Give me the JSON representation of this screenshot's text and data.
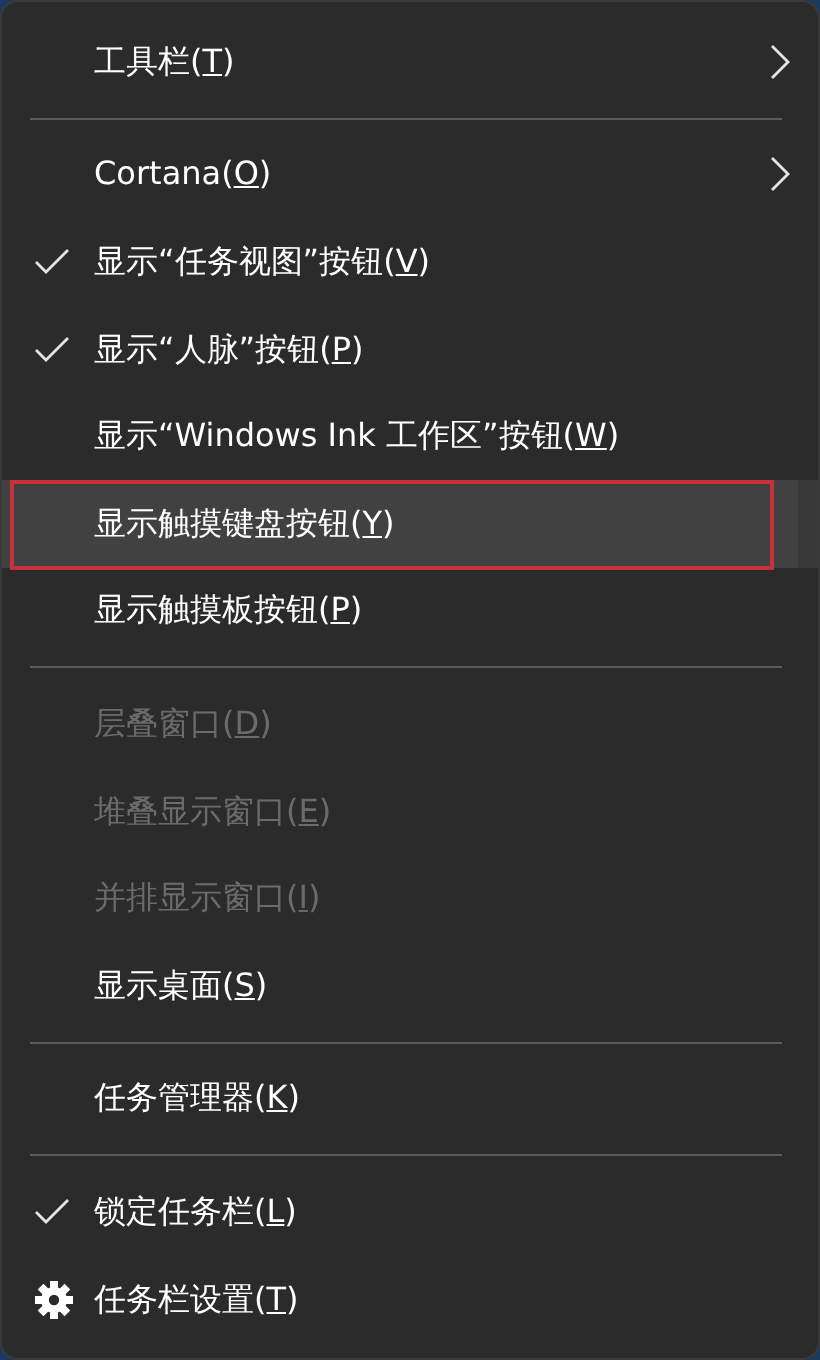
{
  "menu": {
    "sections": [
      {
        "items": [
          {
            "kind": "item",
            "label": "工具栏(T)",
            "checked": false,
            "disabled": false,
            "submenu": true,
            "selected": false
          }
        ]
      },
      {
        "items": [
          {
            "kind": "item",
            "label": "Cortana(O)",
            "checked": false,
            "disabled": false,
            "submenu": true,
            "selected": false
          },
          {
            "kind": "item",
            "label": "显示“任务视图”按钮(V)",
            "checked": true,
            "disabled": false,
            "submenu": false,
            "selected": false
          },
          {
            "kind": "item",
            "label": "显示“人脉”按钮(P)",
            "checked": true,
            "disabled": false,
            "submenu": false,
            "selected": false
          },
          {
            "kind": "item",
            "label": "显示“Windows Ink 工作区”按钮(W)",
            "checked": false,
            "disabled": false,
            "submenu": false,
            "selected": false
          },
          {
            "kind": "item",
            "label": "显示触摸键盘按钮(Y)",
            "checked": false,
            "disabled": false,
            "submenu": false,
            "selected": true
          },
          {
            "kind": "item",
            "label": "显示触摸板按钮(P)",
            "checked": false,
            "disabled": false,
            "submenu": false,
            "selected": false
          }
        ]
      },
      {
        "items": [
          {
            "kind": "item",
            "label": "层叠窗口(D)",
            "checked": false,
            "disabled": true,
            "submenu": false,
            "selected": false
          },
          {
            "kind": "item",
            "label": "堆叠显示窗口(E)",
            "checked": false,
            "disabled": true,
            "submenu": false,
            "selected": false
          },
          {
            "kind": "item",
            "label": "并排显示窗口(I)",
            "checked": false,
            "disabled": true,
            "submenu": false,
            "selected": false
          },
          {
            "kind": "item",
            "label": "显示桌面(S)",
            "checked": false,
            "disabled": false,
            "submenu": false,
            "selected": false
          }
        ]
      },
      {
        "items": [
          {
            "kind": "item",
            "label": "任务管理器(K)",
            "checked": false,
            "disabled": false,
            "submenu": false,
            "selected": false
          }
        ]
      },
      {
        "items": [
          {
            "kind": "item",
            "label": "锁定任务栏(L)",
            "checked": true,
            "disabled": false,
            "submenu": false,
            "selected": false
          },
          {
            "kind": "settings",
            "label": "任务栏设置(T)",
            "checked": false,
            "disabled": false,
            "submenu": false,
            "selected": false
          }
        ]
      }
    ]
  }
}
